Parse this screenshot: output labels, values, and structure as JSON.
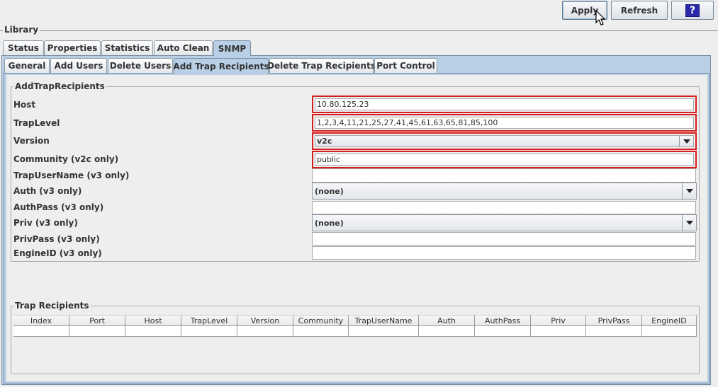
{
  "toolbar": {
    "apply_label": "Apply",
    "refresh_label": "Refresh",
    "help_label": "?"
  },
  "library": {
    "title": "Library"
  },
  "tabs_main": [
    {
      "label": "Status"
    },
    {
      "label": "Properties"
    },
    {
      "label": "Statistics"
    },
    {
      "label": "Auto Clean"
    },
    {
      "label": "SNMP",
      "selected": true
    }
  ],
  "tabs_snmp": [
    {
      "label": "General"
    },
    {
      "label": "Add Users"
    },
    {
      "label": "Delete Users"
    },
    {
      "label": "Add Trap Recipients",
      "selected": true
    },
    {
      "label": "Delete Trap Recipients"
    },
    {
      "label": "Port Control"
    }
  ],
  "form": {
    "group_title": "AddTrapRecipients",
    "host": {
      "label": "Host",
      "value": "10.80.125.23"
    },
    "traplevel": {
      "label": "TrapLevel",
      "value": "1,2,3,4,11,21,25,27,41,45,61,63,65,81,85,100"
    },
    "version": {
      "label": "Version",
      "value": "v2c"
    },
    "community": {
      "label": "Community (v2c only)",
      "value": "public"
    },
    "trapusername": {
      "label": "TrapUserName (v3 only)",
      "value": ""
    },
    "auth": {
      "label": "Auth (v3 only)",
      "value": "(none)"
    },
    "authpass": {
      "label": "AuthPass (v3 only)",
      "value": ""
    },
    "priv": {
      "label": "Priv (v3 only)",
      "value": "(none)"
    },
    "privpass": {
      "label": "PrivPass (v3 only)",
      "value": ""
    },
    "engineid": {
      "label": "EngineID (v3 only)",
      "value": ""
    }
  },
  "table": {
    "title": "Trap Recipients",
    "columns": [
      "Index",
      "Port",
      "Host",
      "TrapLevel",
      "Version",
      "Community",
      "TrapUserName",
      "Auth",
      "AuthPass",
      "Priv",
      "PrivPass",
      "EngineID"
    ],
    "rows": []
  },
  "colors": {
    "error_border": "#d71d1d",
    "selected_tab": "#b8cfe5"
  }
}
